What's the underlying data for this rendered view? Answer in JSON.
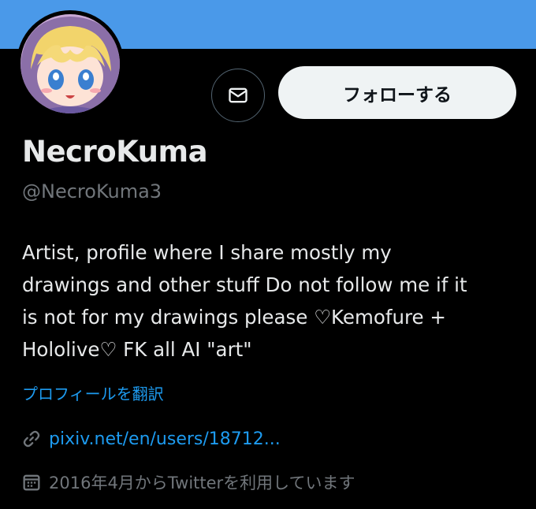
{
  "profile": {
    "name": "NecroKuma",
    "handle": "@NecroKuma3",
    "bio": "Artist, profile where I share mostly my\ndrawings and other stuff Do not follow me if it\nis not for my drawings please ♡Kemofure +\nHololive♡ FK all AI \"art\"",
    "translate_label": "プロフィールを翻訳",
    "website": "pixiv.net/en/users/18712...",
    "joined": "2016年4月からTwitterを利用しています"
  },
  "actions": {
    "follow_label": "フォローする",
    "message_icon": "envelope-icon"
  },
  "colors": {
    "banner": "#4a99e9",
    "background": "#000000",
    "link": "#1d9bf0",
    "muted": "#71767b",
    "text": "#e7e9ea"
  }
}
